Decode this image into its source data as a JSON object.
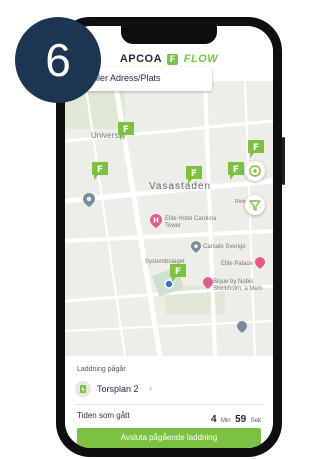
{
  "step_badge": "6",
  "app": {
    "brand_left": "APCOA",
    "brand_mark": "F",
    "brand_right": "FLOW"
  },
  "search": {
    "placeholder": "Skriv Zonkod eller Adress/Plats"
  },
  "map": {
    "labels": {
      "university": "University",
      "district": "Vasastaden",
      "hotel": "Elite Hotel Carolina Tower",
      "carsale": "Carsale Sverige",
      "systembolaget": "Systembolaget",
      "elite_palace": "Elite Palace",
      "bique": "Bique by Nobis Stockholm, a Mem",
      "rodabergsvagen": "Rödabergsv."
    },
    "filter_icon": "filter-icon",
    "locate_icon": "locate-icon"
  },
  "panel": {
    "status_label": "Laddning pågår",
    "station_name": "Torsplan 2",
    "elapsed_label": "Tiden som gått",
    "elapsed_min": "4",
    "min_unit": "Min",
    "elapsed_sec": "59",
    "sec_unit": "Sek",
    "end_button": "Avsluta pågående laddning"
  },
  "colors": {
    "accent": "#7cc242",
    "navy": "#1c3550",
    "poi_pink": "#e45a8a",
    "poi_grey": "#7a8c99"
  }
}
